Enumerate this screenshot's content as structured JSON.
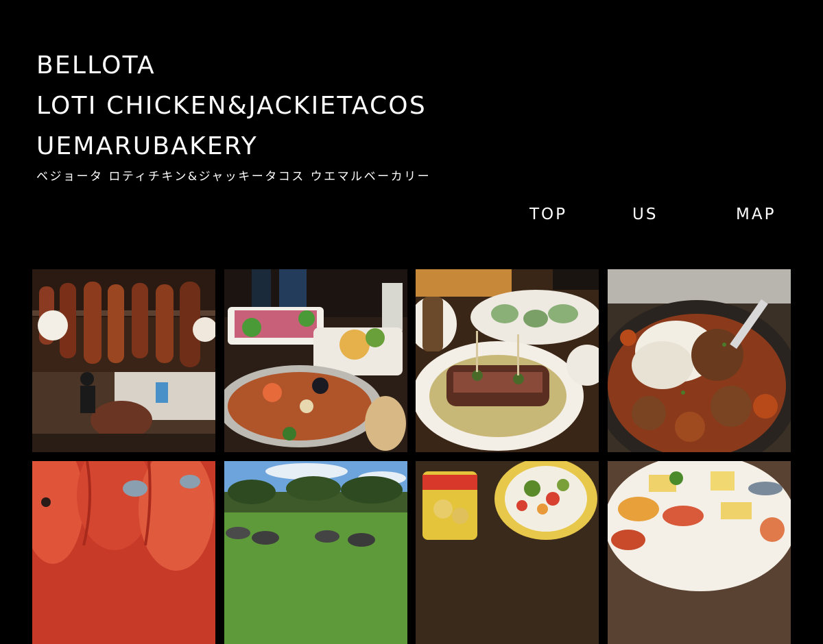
{
  "header": {
    "brand_lines": [
      "BELLOTA",
      "LOTI CHICKEN&JACKIETACOS",
      "UEMARUBAKERY"
    ],
    "brand_kana": "ベジョータ ロティチキン&ジャッキータコス ウエマルベーカリー"
  },
  "nav": {
    "items": [
      {
        "label": "TOP"
      },
      {
        "label": "US"
      },
      {
        "label": "MAP"
      }
    ]
  },
  "gallery": {
    "photos": [
      {
        "subject": "jamon-shop"
      },
      {
        "subject": "paella-table"
      },
      {
        "subject": "steak-skewers"
      },
      {
        "subject": "meatball-cheese"
      },
      {
        "subject": "red-prawns"
      },
      {
        "subject": "pasture-pigs"
      },
      {
        "subject": "tomato-can-salad"
      },
      {
        "subject": "tapas-platter"
      }
    ]
  },
  "colors": {
    "background": "#000000",
    "text": "#ffffff"
  }
}
